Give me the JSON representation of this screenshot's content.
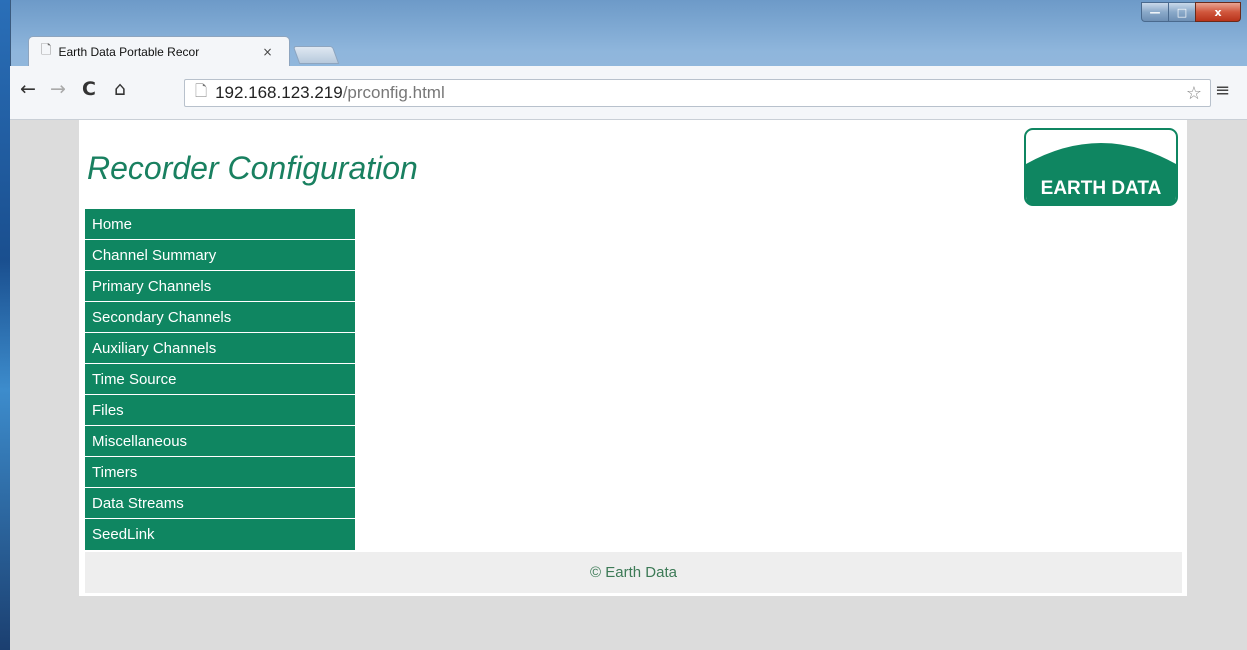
{
  "browser": {
    "tab_title": "Earth Data Portable Recor",
    "tab_close": "×",
    "url_host": "192.168.123.219",
    "url_path": "/prconfig.html",
    "window_controls": {
      "minimize": "—",
      "maximize": "□",
      "close": "x"
    }
  },
  "page": {
    "title": "Recorder Configuration",
    "logo_text": "EARTH DATA",
    "nav": [
      "Home",
      "Channel Summary",
      "Primary Channels",
      "Secondary Channels",
      "Auxiliary Channels",
      "Time Source",
      "Files",
      "Miscellaneous",
      "Timers",
      "Data Streams",
      "SeedLink"
    ],
    "footer": "© Earth Data"
  },
  "colors": {
    "brand_green": "#0f8661",
    "title_green": "#198060"
  }
}
